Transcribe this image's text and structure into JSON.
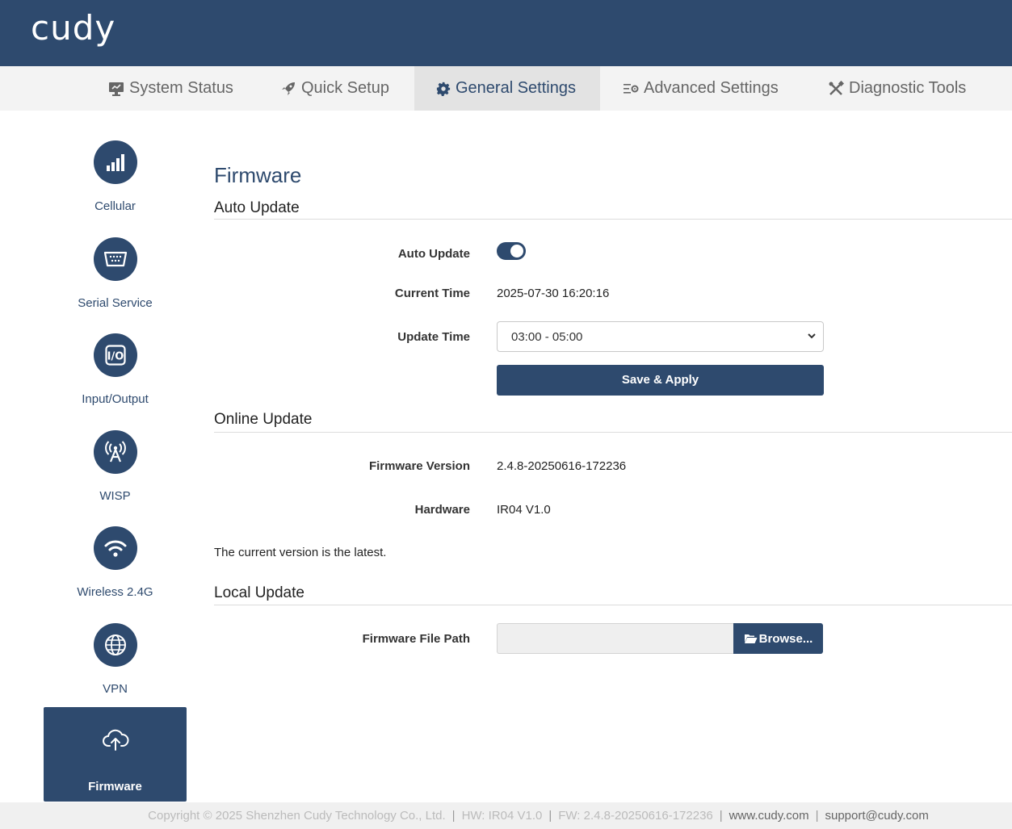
{
  "header": {
    "logo": "cudy"
  },
  "nav": {
    "items": [
      {
        "label": "System Status",
        "icon": "monitor-icon"
      },
      {
        "label": "Quick Setup",
        "icon": "rocket-icon"
      },
      {
        "label": "General Settings",
        "icon": "gear-icon",
        "active": true
      },
      {
        "label": "Advanced Settings",
        "icon": "advanced-settings-icon"
      },
      {
        "label": "Diagnostic Tools",
        "icon": "tools-icon"
      }
    ]
  },
  "sidebar": {
    "items": [
      {
        "label": "Cellular",
        "icon": "signal-bars-icon"
      },
      {
        "label": "Serial Service",
        "icon": "serial-port-icon"
      },
      {
        "label": "Input/Output",
        "icon": "io-icon"
      },
      {
        "label": "WISP",
        "icon": "antenna-icon"
      },
      {
        "label": "Wireless 2.4G",
        "icon": "wifi-icon"
      },
      {
        "label": "VPN",
        "icon": "globe-icon"
      },
      {
        "label": "Firmware",
        "icon": "cloud-upload-icon",
        "active": true
      }
    ]
  },
  "main": {
    "title": "Firmware",
    "auto_update": {
      "section_title": "Auto Update",
      "toggle_label": "Auto Update",
      "toggle_on": true,
      "current_time_label": "Current Time",
      "current_time_value": "2025-07-30 16:20:16",
      "update_time_label": "Update Time",
      "update_time_value": "03:00 - 05:00",
      "save_button": "Save & Apply"
    },
    "online_update": {
      "section_title": "Online Update",
      "firmware_version_label": "Firmware Version",
      "firmware_version_value": "2.4.8-20250616-172236",
      "hardware_label": "Hardware",
      "hardware_value": "IR04 V1.0",
      "status_note": "The current version is the latest."
    },
    "local_update": {
      "section_title": "Local Update",
      "file_path_label": "Firmware File Path",
      "file_path_value": "",
      "browse_button": "Browse..."
    }
  },
  "footer": {
    "copyright": "Copyright © 2025 Shenzhen Cudy Technology Co., Ltd.",
    "hw": "HW: IR04 V1.0",
    "fw": "FW: 2.4.8-20250616-172236",
    "website": "www.cudy.com",
    "email": "support@cudy.com"
  },
  "colors": {
    "brand": "#2e4a6e",
    "nav_bg": "#f3f3f3",
    "footer_bg": "#f0f0f0"
  }
}
